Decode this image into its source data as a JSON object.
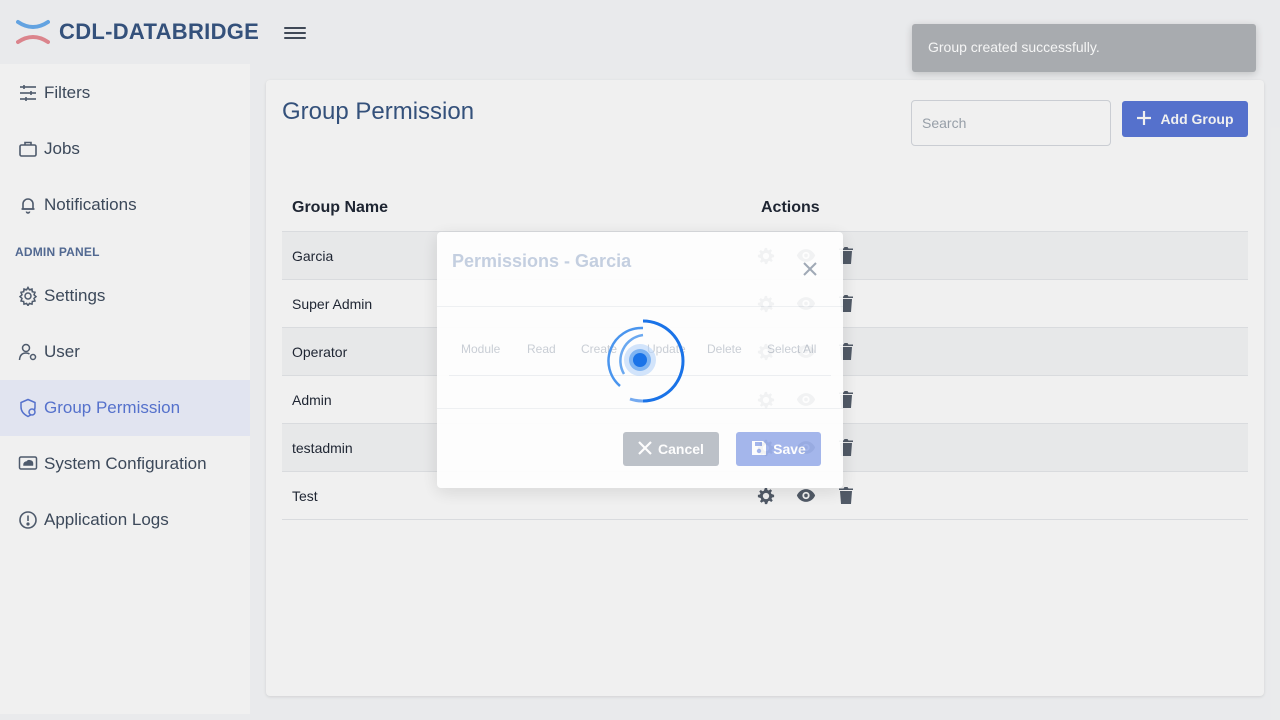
{
  "app": {
    "brand": "CDL-DATABRIDGE"
  },
  "sidebar": {
    "items": [
      {
        "label": "Filters",
        "icon": "sliders-icon"
      },
      {
        "label": "Jobs",
        "icon": "briefcase-icon"
      },
      {
        "label": "Notifications",
        "icon": "bell-icon"
      },
      {
        "label": "Settings",
        "icon": "gear-icon"
      },
      {
        "label": "User",
        "icon": "user-gear-icon"
      },
      {
        "label": "Group Permission",
        "icon": "shield-gear-icon",
        "active": true
      },
      {
        "label": "System Configuration",
        "icon": "cloud-monitor-icon"
      },
      {
        "label": "Application Logs",
        "icon": "alert-circle-icon"
      }
    ],
    "section_label": "ADMIN PANEL"
  },
  "page": {
    "title": "Group Permission",
    "search_placeholder": "Search",
    "add_button": "Add Group"
  },
  "table": {
    "headers": {
      "name": "Group Name",
      "actions": "Actions"
    },
    "rows": [
      "Garcia",
      "Super Admin",
      "Operator",
      "Admin",
      "testadmin",
      "Test"
    ]
  },
  "modal": {
    "title": "Permissions - Garcia",
    "columns": [
      "Module",
      "Read",
      "Create",
      "Update",
      "Delete",
      "Select All"
    ],
    "cancel": "Cancel",
    "save": "Save"
  },
  "toast": {
    "message": "Group created successfully."
  },
  "colors": {
    "primary": "#4f6fd6",
    "brand": "#2a4a7a",
    "spinner": "#1a73e8"
  }
}
